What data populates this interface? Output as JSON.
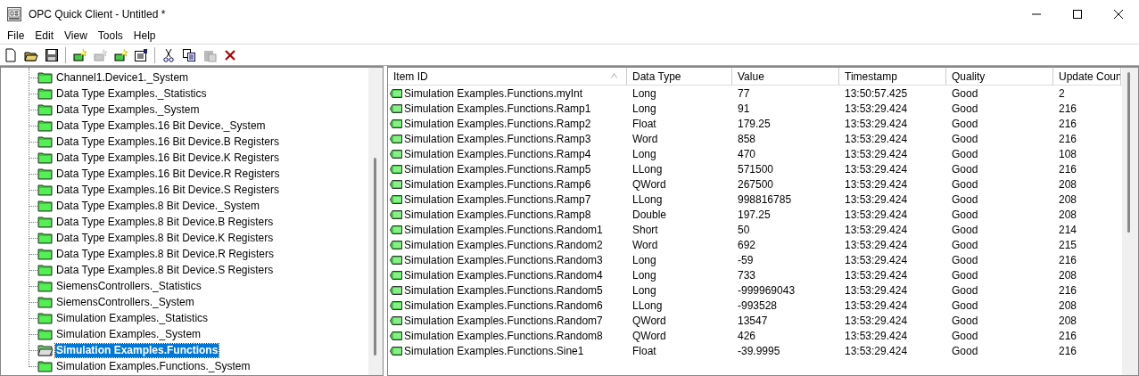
{
  "window": {
    "title": "OPC Quick Client - Untitled *"
  },
  "menu": [
    "File",
    "Edit",
    "View",
    "Tools",
    "Help"
  ],
  "toolbar": [
    {
      "kind": "new",
      "disabled": false
    },
    {
      "kind": "open",
      "disabled": false
    },
    {
      "kind": "save",
      "disabled": false
    },
    {
      "kind": "sep"
    },
    {
      "kind": "server",
      "disabled": false
    },
    {
      "kind": "group",
      "disabled": true
    },
    {
      "kind": "item",
      "disabled": false
    },
    {
      "kind": "properties",
      "disabled": false
    },
    {
      "kind": "sep"
    },
    {
      "kind": "cut",
      "disabled": false
    },
    {
      "kind": "copy",
      "disabled": false
    },
    {
      "kind": "paste",
      "disabled": true
    },
    {
      "kind": "delete",
      "disabled": false
    }
  ],
  "tree": [
    {
      "label": "Channel1.Device1._System",
      "selected": false
    },
    {
      "label": "Data Type Examples._Statistics",
      "selected": false
    },
    {
      "label": "Data Type Examples._System",
      "selected": false
    },
    {
      "label": "Data Type Examples.16 Bit Device._System",
      "selected": false
    },
    {
      "label": "Data Type Examples.16 Bit Device.B Registers",
      "selected": false
    },
    {
      "label": "Data Type Examples.16 Bit Device.K Registers",
      "selected": false
    },
    {
      "label": "Data Type Examples.16 Bit Device.R Registers",
      "selected": false
    },
    {
      "label": "Data Type Examples.16 Bit Device.S Registers",
      "selected": false
    },
    {
      "label": "Data Type Examples.8 Bit Device._System",
      "selected": false
    },
    {
      "label": "Data Type Examples.8 Bit Device.B Registers",
      "selected": false
    },
    {
      "label": "Data Type Examples.8 Bit Device.K Registers",
      "selected": false
    },
    {
      "label": "Data Type Examples.8 Bit Device.R Registers",
      "selected": false
    },
    {
      "label": "Data Type Examples.8 Bit Device.S Registers",
      "selected": false
    },
    {
      "label": "SiemensControllers._Statistics",
      "selected": false
    },
    {
      "label": "SiemensControllers._System",
      "selected": false
    },
    {
      "label": "Simulation Examples._Statistics",
      "selected": false
    },
    {
      "label": "Simulation Examples._System",
      "selected": false
    },
    {
      "label": "Simulation Examples.Functions",
      "selected": true
    },
    {
      "label": "Simulation Examples.Functions._System",
      "selected": false
    }
  ],
  "table": {
    "columns": [
      {
        "label": "Item ID",
        "sorted": true
      },
      {
        "label": "Data Type",
        "sorted": false
      },
      {
        "label": "Value",
        "sorted": false
      },
      {
        "label": "Timestamp",
        "sorted": false
      },
      {
        "label": "Quality",
        "sorted": false
      },
      {
        "label": "Update Coun",
        "sorted": false
      }
    ],
    "rows": [
      [
        "Simulation Examples.Functions.myInt",
        "Long",
        "77",
        "13:50:57.425",
        "Good",
        "2"
      ],
      [
        "Simulation Examples.Functions.Ramp1",
        "Long",
        "91",
        "13:53:29.424",
        "Good",
        "216"
      ],
      [
        "Simulation Examples.Functions.Ramp2",
        "Float",
        "179.25",
        "13:53:29.424",
        "Good",
        "216"
      ],
      [
        "Simulation Examples.Functions.Ramp3",
        "Word",
        "858",
        "13:53:29.424",
        "Good",
        "216"
      ],
      [
        "Simulation Examples.Functions.Ramp4",
        "Long",
        "470",
        "13:53:29.424",
        "Good",
        "108"
      ],
      [
        "Simulation Examples.Functions.Ramp5",
        "LLong",
        "571500",
        "13:53:29.424",
        "Good",
        "216"
      ],
      [
        "Simulation Examples.Functions.Ramp6",
        "QWord",
        "267500",
        "13:53:29.424",
        "Good",
        "208"
      ],
      [
        "Simulation Examples.Functions.Ramp7",
        "LLong",
        "998816785",
        "13:53:29.424",
        "Good",
        "208"
      ],
      [
        "Simulation Examples.Functions.Ramp8",
        "Double",
        "197.25",
        "13:53:29.424",
        "Good",
        "208"
      ],
      [
        "Simulation Examples.Functions.Random1",
        "Short",
        "50",
        "13:53:29.424",
        "Good",
        "214"
      ],
      [
        "Simulation Examples.Functions.Random2",
        "Word",
        "692",
        "13:53:29.424",
        "Good",
        "215"
      ],
      [
        "Simulation Examples.Functions.Random3",
        "Long",
        "-59",
        "13:53:29.424",
        "Good",
        "216"
      ],
      [
        "Simulation Examples.Functions.Random4",
        "Long",
        "733",
        "13:53:29.424",
        "Good",
        "208"
      ],
      [
        "Simulation Examples.Functions.Random5",
        "Long",
        "-999969043",
        "13:53:29.424",
        "Good",
        "216"
      ],
      [
        "Simulation Examples.Functions.Random6",
        "LLong",
        "-993528",
        "13:53:29.424",
        "Good",
        "208"
      ],
      [
        "Simulation Examples.Functions.Random7",
        "QWord",
        "13547",
        "13:53:29.424",
        "Good",
        "208"
      ],
      [
        "Simulation Examples.Functions.Random8",
        "QWord",
        "426",
        "13:53:29.424",
        "Good",
        "216"
      ],
      [
        "Simulation Examples.Functions.Sine1",
        "Float",
        "-39.9995",
        "13:53:29.424",
        "Good",
        "216"
      ]
    ]
  }
}
